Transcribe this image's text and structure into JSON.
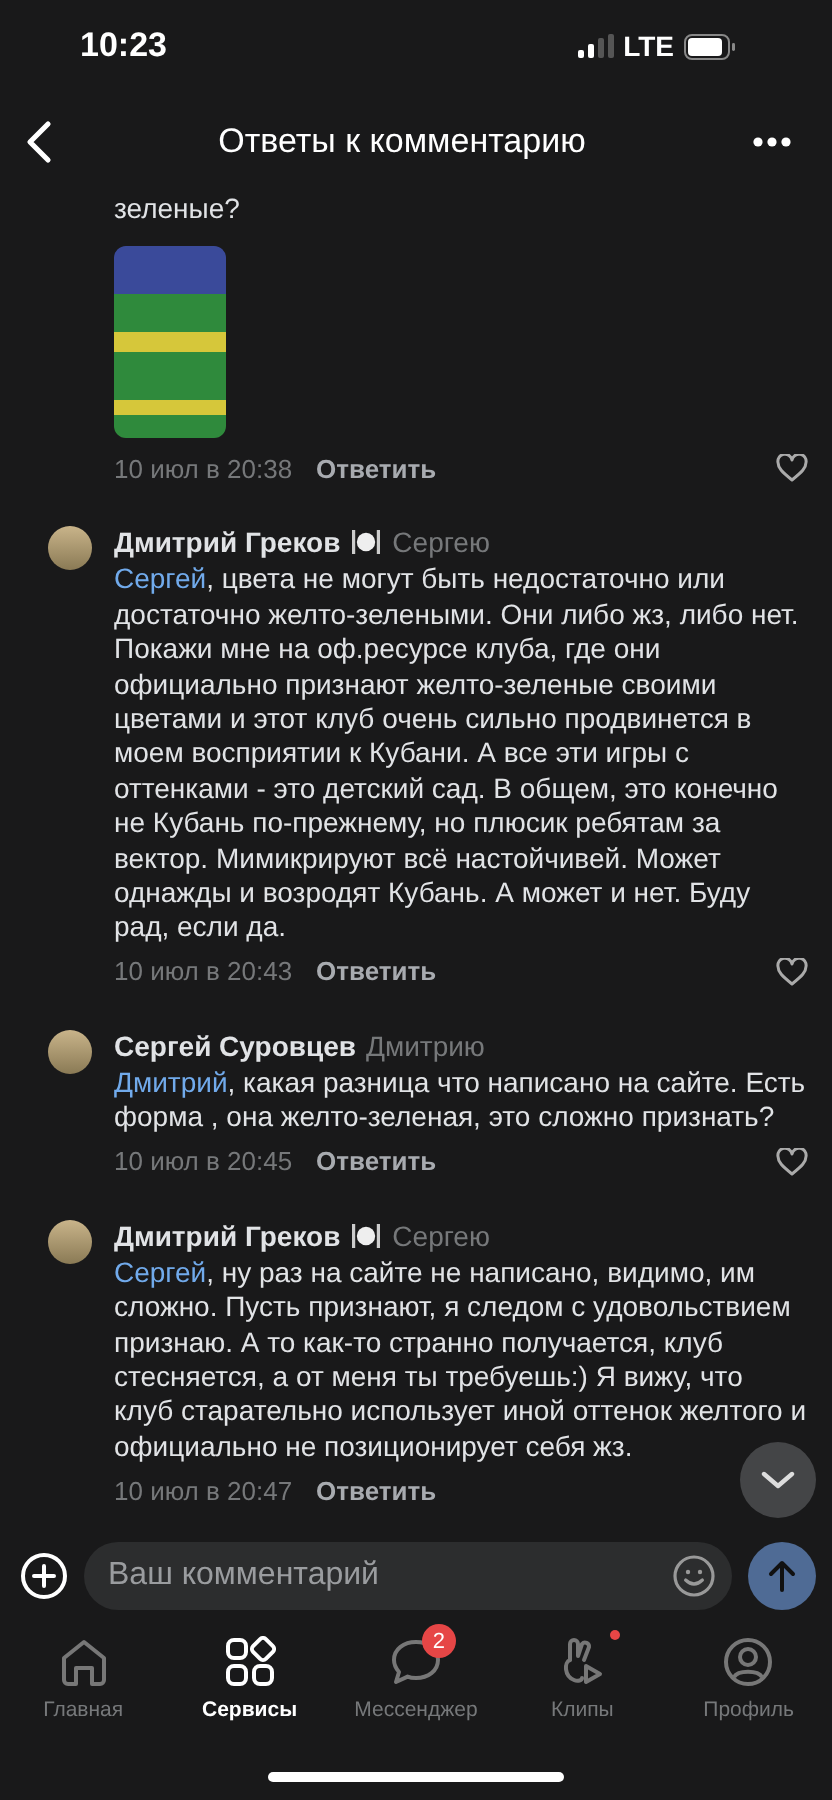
{
  "status_bar": {
    "time": "10:23",
    "network": "LTE"
  },
  "header": {
    "title": "Ответы к комментарию"
  },
  "comments": [
    {
      "kind": "partial",
      "text_tail": "зеленые?",
      "has_photo": true,
      "date": "10 июл в 20:38",
      "reply": "Ответить",
      "like_button": true
    },
    {
      "kind": "full",
      "author": "Дмитрий Греков",
      "badge_icon": true,
      "reply_to": "Сергею",
      "mention": "Сергей",
      "text": ", цвета не могут быть недостаточно или достаточно желто-зелеными. Они либо жз, либо нет. Покажи мне на оф.ресурсе клуба, где они официально признают желто-зеленые своими цветами и этот клуб очень сильно продвинется в моем восприятии к Кубани. А все эти игры с оттенками - это детский сад. В общем, это конечно не Кубань по-прежнему, но плюсик ребятам за вектор. Мимикрируют всё настойчивей. Может однажды и возродят Кубань. А может и нет. Буду рад, если да.",
      "date": "10 июл в 20:43",
      "reply": "Ответить",
      "like_button": true
    },
    {
      "kind": "full",
      "author": "Сергей Суровцев",
      "badge_icon": false,
      "reply_to": "Дмитрию",
      "mention": "Дмитрий",
      "text": ", какая разница что написано на сайте. Есть форма , она желто-зеленая, это сложно признать?",
      "date": "10 июл в 20:45",
      "reply": "Ответить",
      "like_button": true
    },
    {
      "kind": "full",
      "author": "Дмитрий Греков",
      "badge_icon": true,
      "reply_to": "Сергею",
      "mention": "Сергей",
      "text": ", ну раз на сайте не написано, видимо, им сложно. Пусть признают, я следом с удовольствием признаю. А то как-то странно получается, клуб стесняется, а от меня ты требуешь:) Я вижу, что клуб старательно использует иной оттенок желтого и официально не позиционирует себя жз.",
      "date": "10 июл в 20:47",
      "reply": "Ответить",
      "like_button": false
    }
  ],
  "composer": {
    "placeholder": "Ваш комментарий"
  },
  "tab_bar": [
    {
      "kind": "home",
      "label": "Главная",
      "selected": false
    },
    {
      "kind": "services",
      "label": "Сервисы",
      "selected": true
    },
    {
      "kind": "messenger",
      "label": "Мессенджер",
      "selected": false,
      "badge": "2"
    },
    {
      "kind": "clips",
      "label": "Клипы",
      "selected": false,
      "dot": true
    },
    {
      "kind": "profile",
      "label": "Профиль",
      "selected": false
    }
  ]
}
